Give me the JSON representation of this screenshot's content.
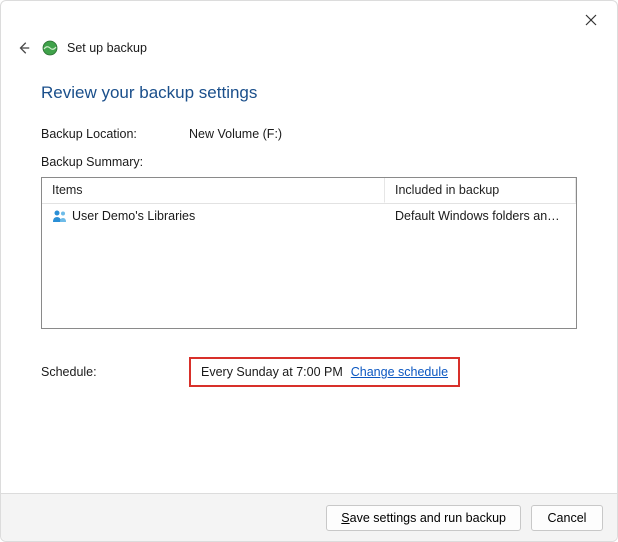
{
  "header": {
    "title": "Set up backup"
  },
  "page": {
    "heading": "Review your backup settings"
  },
  "location": {
    "label": "Backup Location:",
    "value": "New Volume (F:)"
  },
  "summary": {
    "label": "Backup Summary:",
    "columns": {
      "items": "Items",
      "included": "Included in backup"
    },
    "rows": [
      {
        "item": "User Demo's Libraries",
        "included": "Default Windows folders and lo…"
      }
    ]
  },
  "schedule": {
    "label": "Schedule:",
    "value": "Every Sunday at 7:00 PM",
    "link_text": "Change schedule"
  },
  "buttons": {
    "save_prefix": "S",
    "save_rest": "ave settings and run backup",
    "cancel": "Cancel"
  }
}
